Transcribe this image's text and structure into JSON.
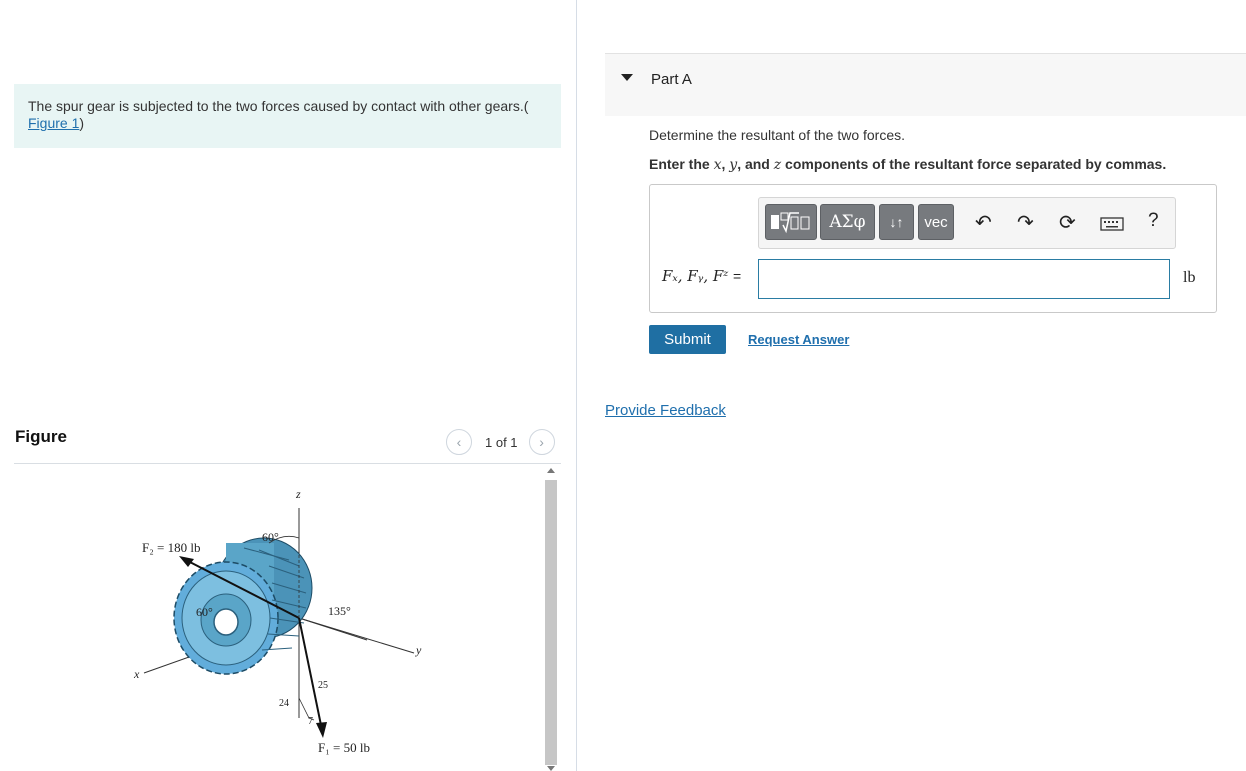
{
  "problem": {
    "text": "The spur gear is subjected to the two forces caused by contact with other gears.(",
    "figure_link": "Figure 1",
    "close": ")"
  },
  "figure_panel": {
    "title": "Figure",
    "pager_text": "1 of 1",
    "prev_icon": "chevron-left-icon",
    "next_icon": "chevron-right-icon",
    "labels": {
      "f2": "F₂ = 180 lb",
      "f1": "F₁ = 50 lb",
      "angle_60_top": "60°",
      "angle_60_gear": "60°",
      "angle_135": "135°",
      "axis_z": "z",
      "axis_y": "y",
      "axis_x": "x",
      "slope_24": "24",
      "slope_25": "25",
      "slope_7": "7"
    }
  },
  "part": {
    "title": "Part A",
    "question": "Determine the resultant of the two forces.",
    "instruction_pre": "Enter the ",
    "var_x": "x",
    "sep1": ", ",
    "var_y": "y",
    "sep2": ", and ",
    "var_z": "z",
    "instruction_post": " components of the resultant force separated by commas.",
    "toolbar": {
      "matrix_icon": "templates-icon",
      "greek_label": "ΑΣφ",
      "arrows_label": "↓↑",
      "vec_label": "vec",
      "undo_icon": "↶",
      "redo_icon": "↷",
      "reset_icon": "⟳",
      "keyboard_icon": "keyboard-icon",
      "help_label": "?"
    },
    "equation_label": "Fₓ, Fᵧ, Fᶻ",
    "equals": "=",
    "input_value": "",
    "unit": "lb",
    "submit_label": "Submit",
    "request_label": "Request Answer"
  },
  "feedback_label": "Provide Feedback",
  "colors": {
    "accent": "#1f6fa3",
    "problem_bg": "#e8f5f4",
    "gear": "#5aa5c8"
  }
}
